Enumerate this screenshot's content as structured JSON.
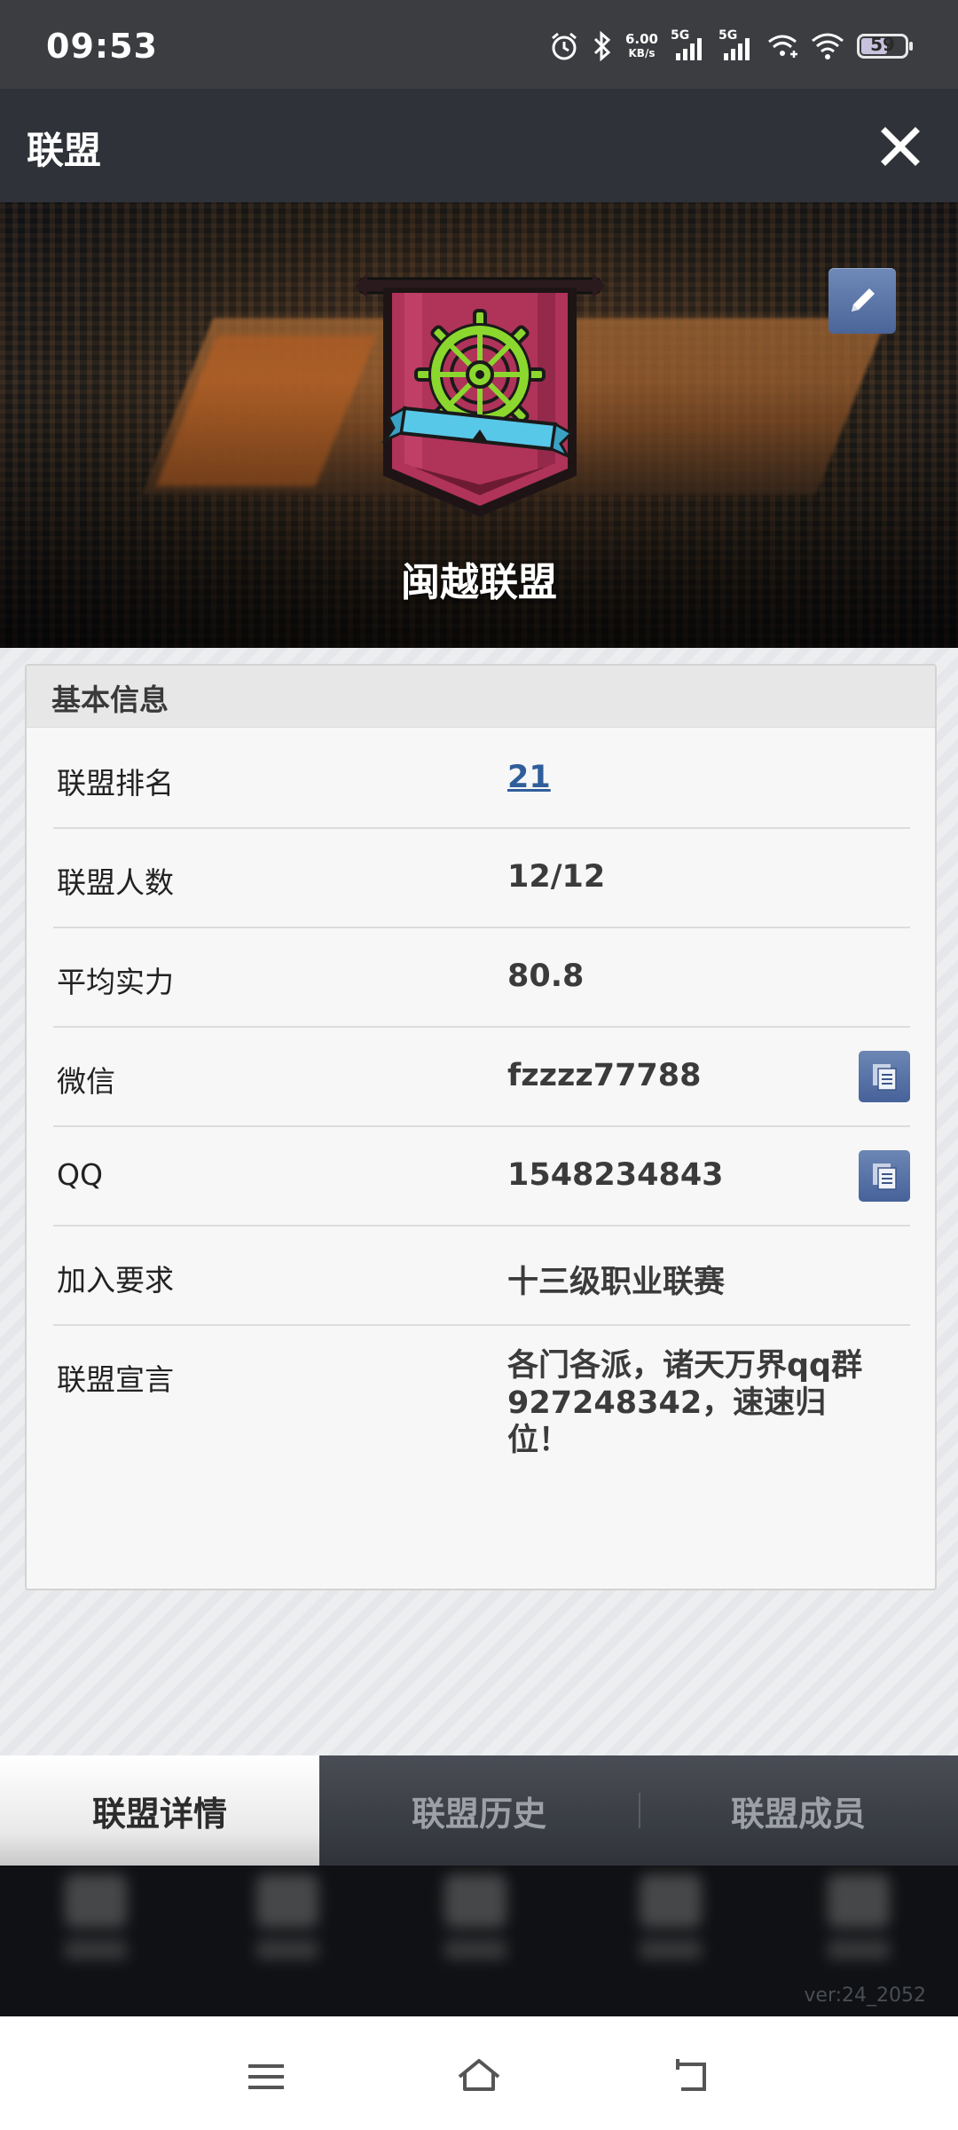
{
  "status_bar": {
    "time": "09:53",
    "net_speed_value": "6.00",
    "net_speed_unit": "KB/s",
    "signal1_label": "5G",
    "signal2_label": "5G",
    "battery": "59"
  },
  "header": {
    "title": "联盟"
  },
  "banner": {
    "alliance_name": "闽越联盟"
  },
  "basic_info": {
    "section_title": "基本信息",
    "rows": [
      {
        "label": "联盟排名",
        "value": "21"
      },
      {
        "label": "联盟人数",
        "value": "12/12"
      },
      {
        "label": "平均实力",
        "value": "80.8"
      },
      {
        "label": "微信",
        "value": "fzzzz77788"
      },
      {
        "label": "QQ",
        "value": "1548234843"
      },
      {
        "label": "加入要求",
        "value": "十三级职业联赛"
      },
      {
        "label": "联盟宣言",
        "value": "各门各派，诸天万界qq群927248342，速速归位！"
      }
    ]
  },
  "tabs": [
    {
      "label": "联盟详情",
      "active": true
    },
    {
      "label": "联盟历史",
      "active": false
    },
    {
      "label": "联盟成员",
      "active": false
    }
  ],
  "footer": {
    "version": "ver:24_2052"
  },
  "colors": {
    "accent_blue": "#4a6598",
    "link_blue": "#2f5e9a",
    "header_bg": "#2f3238"
  }
}
